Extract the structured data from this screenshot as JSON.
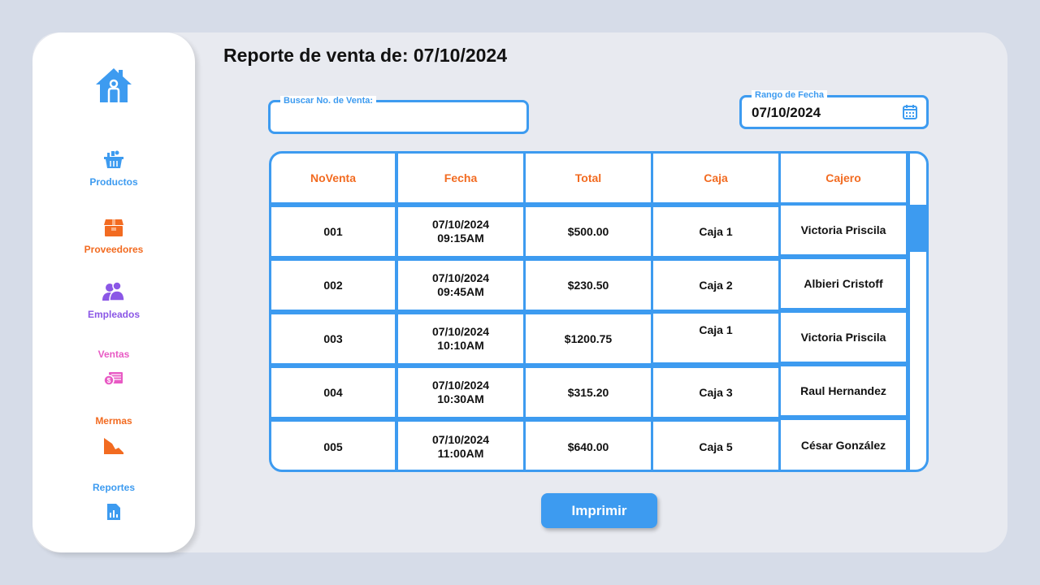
{
  "title": "Reporte de venta de: 07/10/2024",
  "sidebar": {
    "items": [
      {
        "label": "Productos",
        "icon": "basket-icon"
      },
      {
        "label": "Proveedores",
        "icon": "box-icon"
      },
      {
        "label": "Empleados",
        "icon": "users-icon"
      },
      {
        "label": "Ventas",
        "icon": "money-icon"
      },
      {
        "label": "Mermas",
        "icon": "decline-chart-icon"
      },
      {
        "label": "Reportes",
        "icon": "report-icon"
      }
    ]
  },
  "search": {
    "label": "Buscar No. de Venta:",
    "value": "",
    "placeholder": ""
  },
  "date_range": {
    "label": "Rango de Fecha",
    "value": "07/10/2024"
  },
  "table": {
    "headers": [
      "NoVenta",
      "Fecha",
      "Total",
      "Caja",
      "Cajero"
    ],
    "rows": [
      {
        "no": "001",
        "date": "07/10/2024",
        "time": "09:15AM",
        "total": "$500.00",
        "caja": "Caja 1",
        "cajero": "Victoria Priscila"
      },
      {
        "no": "002",
        "date": "07/10/2024",
        "time": "09:45AM",
        "total": "$230.50",
        "caja": "Caja 2",
        "cajero": "Albieri Cristoff"
      },
      {
        "no": "003",
        "date": "07/10/2024",
        "time": "10:10AM",
        "total": "$1200.75",
        "caja": "Caja 1",
        "cajero": "Victoria Priscila"
      },
      {
        "no": "004",
        "date": "07/10/2024",
        "time": "10:30AM",
        "total": "$315.20",
        "caja": "Caja 3",
        "cajero": "Raul Hernandez"
      },
      {
        "no": "005",
        "date": "07/10/2024",
        "time": "11:00AM",
        "total": "$640.00",
        "caja": "Caja 5",
        "cajero": "César González"
      }
    ]
  },
  "print_label": "Imprimir",
  "colors": {
    "accent": "#3d9bf0",
    "header_text": "#f26b21",
    "background": "#d6dce8",
    "panel": "#e8eaf0"
  }
}
